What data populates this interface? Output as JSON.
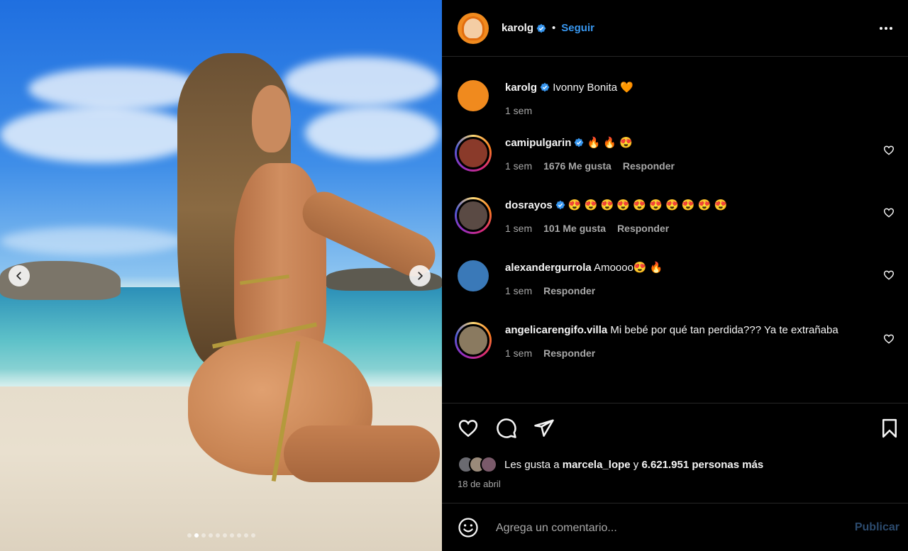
{
  "post": {
    "username": "karolg",
    "follow_label": "Seguir",
    "separator": "•",
    "more_icon": "more-options-icon"
  },
  "comments": [
    {
      "username": "karolg",
      "text": "Ivonny Bonita 🧡",
      "time": "1 sem",
      "likes": "",
      "reply": "",
      "verified": true,
      "caption": true
    },
    {
      "username": "camipulgarin",
      "text": "🔥 🔥 😍",
      "time": "1 sem",
      "likes": "1676 Me gusta",
      "reply": "Responder",
      "verified": true
    },
    {
      "username": "dosrayos",
      "text": "😍 😍 😍 😍 😍 😍 😍 😍 😍 😍",
      "time": "1 sem",
      "likes": "101 Me gusta",
      "reply": "Responder",
      "verified": true
    },
    {
      "username": "alexandergurrola",
      "text": "Amoooo😍 🔥",
      "time": "1 sem",
      "likes": "",
      "reply": "Responder",
      "verified": false
    },
    {
      "username": "angelicarengifo.villa",
      "text": "Mi bebé por qué tan perdida??? Ya te extrañaba",
      "time": "1 sem",
      "likes": "",
      "reply": "Responder",
      "verified": false
    }
  ],
  "likes": {
    "prefix": "Les gusta a",
    "user": "marcela_lope",
    "connector": "y",
    "count": "6.621.951 personas más"
  },
  "date": "18 de abril",
  "add_comment": {
    "placeholder": "Agrega un comentario...",
    "publish_label": "Publicar"
  },
  "carousel": {
    "total_slides": 10,
    "active_index": 1
  },
  "colors": {
    "accent": "#3897f0",
    "publish_disabled": "#2c4b6e",
    "secondary_text": "#a8a8a8",
    "background": "#000000"
  }
}
